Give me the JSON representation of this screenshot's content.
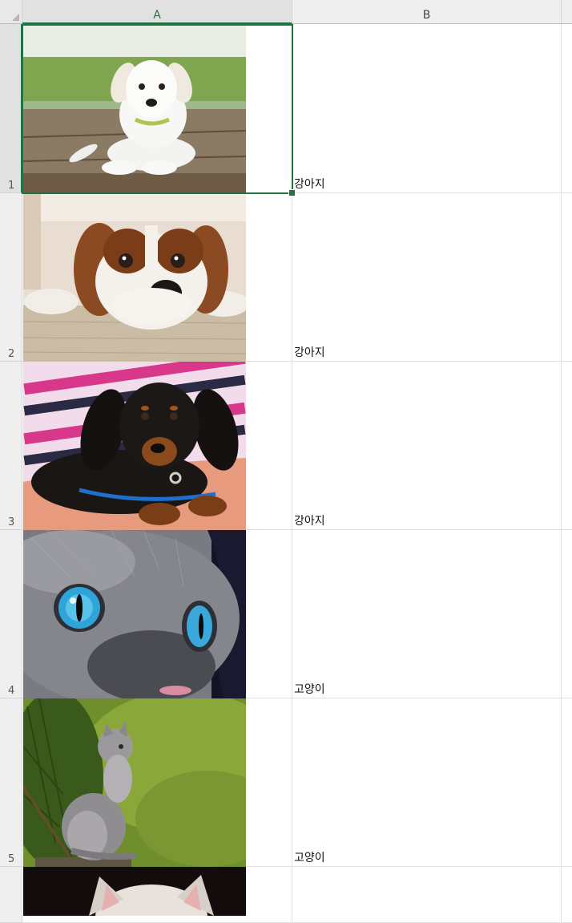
{
  "sheet": {
    "columns": [
      {
        "label": "A",
        "selected": true
      },
      {
        "label": "B",
        "selected": false
      }
    ],
    "rows": [
      {
        "number": "1",
        "picture": "white-puppy",
        "b_value": "강아지"
      },
      {
        "number": "2",
        "picture": "cavalier-puppy",
        "b_value": "강아지"
      },
      {
        "number": "3",
        "picture": "dachshund-puppy",
        "b_value": "강아지"
      },
      {
        "number": "4",
        "picture": "blue-eyed-gray-cat",
        "b_value": "고양이"
      },
      {
        "number": "5",
        "picture": "gray-kitten-in-grass",
        "b_value": "고양이"
      },
      {
        "number": "",
        "picture": "white-cat-partial",
        "b_value": ""
      }
    ],
    "active_cell": "A1"
  },
  "colors": {
    "accent": "#217346",
    "header_bg": "#efefef",
    "gridline": "#e1e1e1"
  }
}
